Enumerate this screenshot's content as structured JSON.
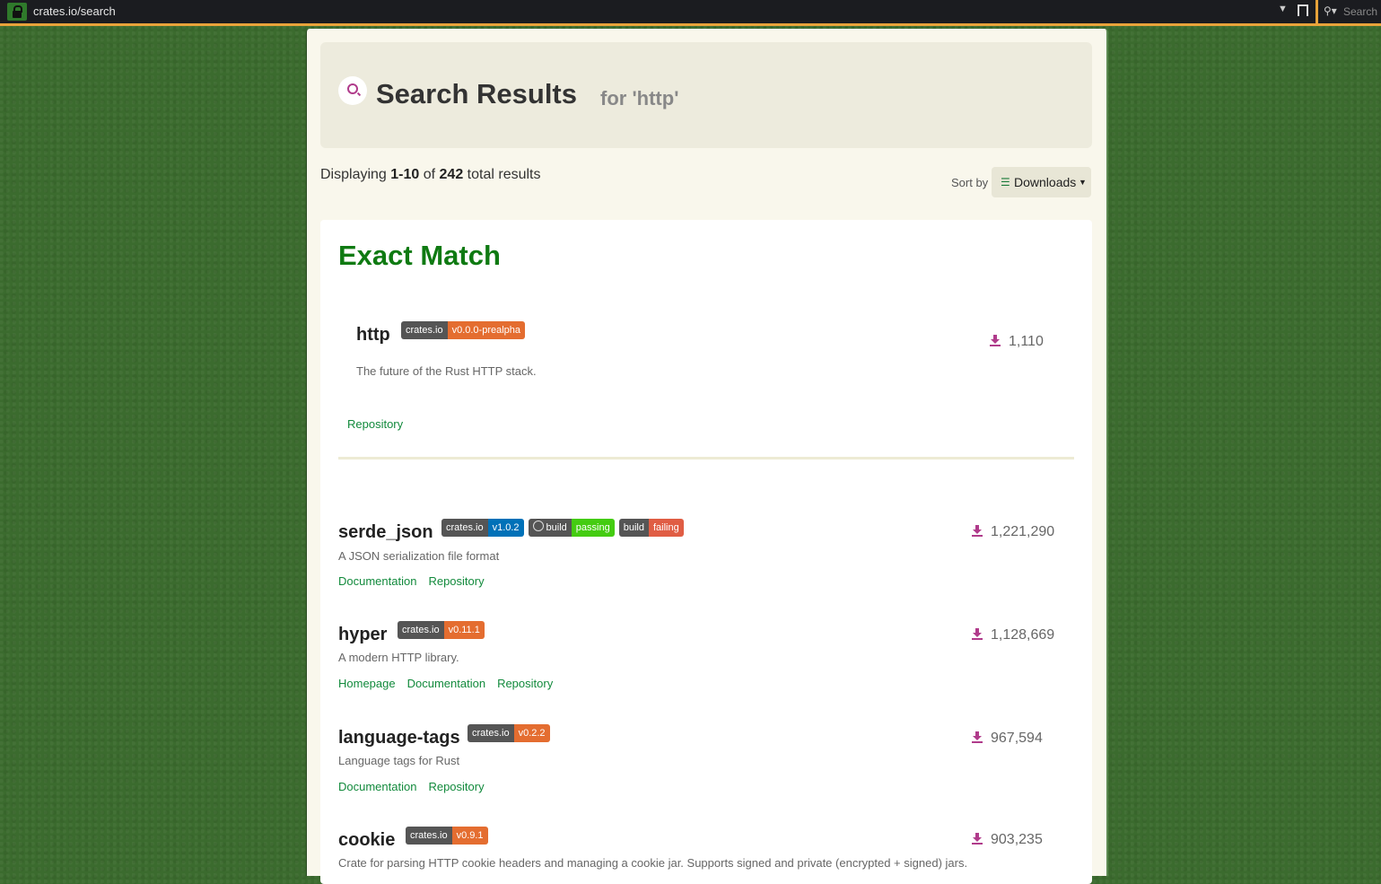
{
  "browser": {
    "url": "crates.io/search",
    "search_placeholder": "Search"
  },
  "header": {
    "title": "Search Results",
    "subtitle": "for 'http'"
  },
  "summary": {
    "prefix": "Displaying ",
    "range": "1-10",
    "of": " of ",
    "total": "242",
    "suffix": " total results"
  },
  "sort": {
    "label": "Sort by",
    "value": "Downloads"
  },
  "exact": {
    "heading": "Exact Match",
    "crate": {
      "name": "http",
      "badges": [
        {
          "left": "crates.io",
          "right": "v0.0.0-prealpha",
          "color": "orange"
        }
      ],
      "description": "The future of the Rust HTTP stack.",
      "downloads": "1,110",
      "links": [
        "Repository"
      ]
    }
  },
  "results": [
    {
      "name": "serde_json",
      "badges": [
        {
          "left": "crates.io",
          "right": "v1.0.2",
          "color": "blue"
        },
        {
          "left": "build",
          "right": "passing",
          "color": "green",
          "icon": "github-icon"
        },
        {
          "left": "build",
          "right": "failing",
          "color": "red"
        }
      ],
      "description": "A JSON serialization file format",
      "links": [
        "Documentation",
        "Repository"
      ],
      "downloads": "1,221,290"
    },
    {
      "name": "hyper",
      "badges": [
        {
          "left": "crates.io",
          "right": "v0.11.1",
          "color": "orange"
        }
      ],
      "description": "A modern HTTP library.",
      "links": [
        "Homepage",
        "Documentation",
        "Repository"
      ],
      "downloads": "1,128,669"
    },
    {
      "name": "language-tags",
      "badges": [
        {
          "left": "crates.io",
          "right": "v0.2.2",
          "color": "orange"
        }
      ],
      "description": "Language tags for Rust",
      "links": [
        "Documentation",
        "Repository"
      ],
      "downloads": "967,594"
    },
    {
      "name": "cookie",
      "badges": [
        {
          "left": "crates.io",
          "right": "v0.9.1",
          "color": "orange"
        }
      ],
      "description": "Crate for parsing HTTP cookie headers and managing a cookie jar. Supports signed and private (encrypted + signed) jars.",
      "links": [],
      "downloads": "903,235"
    }
  ],
  "colors": {
    "accent_green": "#0f7a12",
    "link_green": "#128a3c",
    "download_icon": "#b03b8b",
    "toolbar_accent": "#e8a33a"
  }
}
